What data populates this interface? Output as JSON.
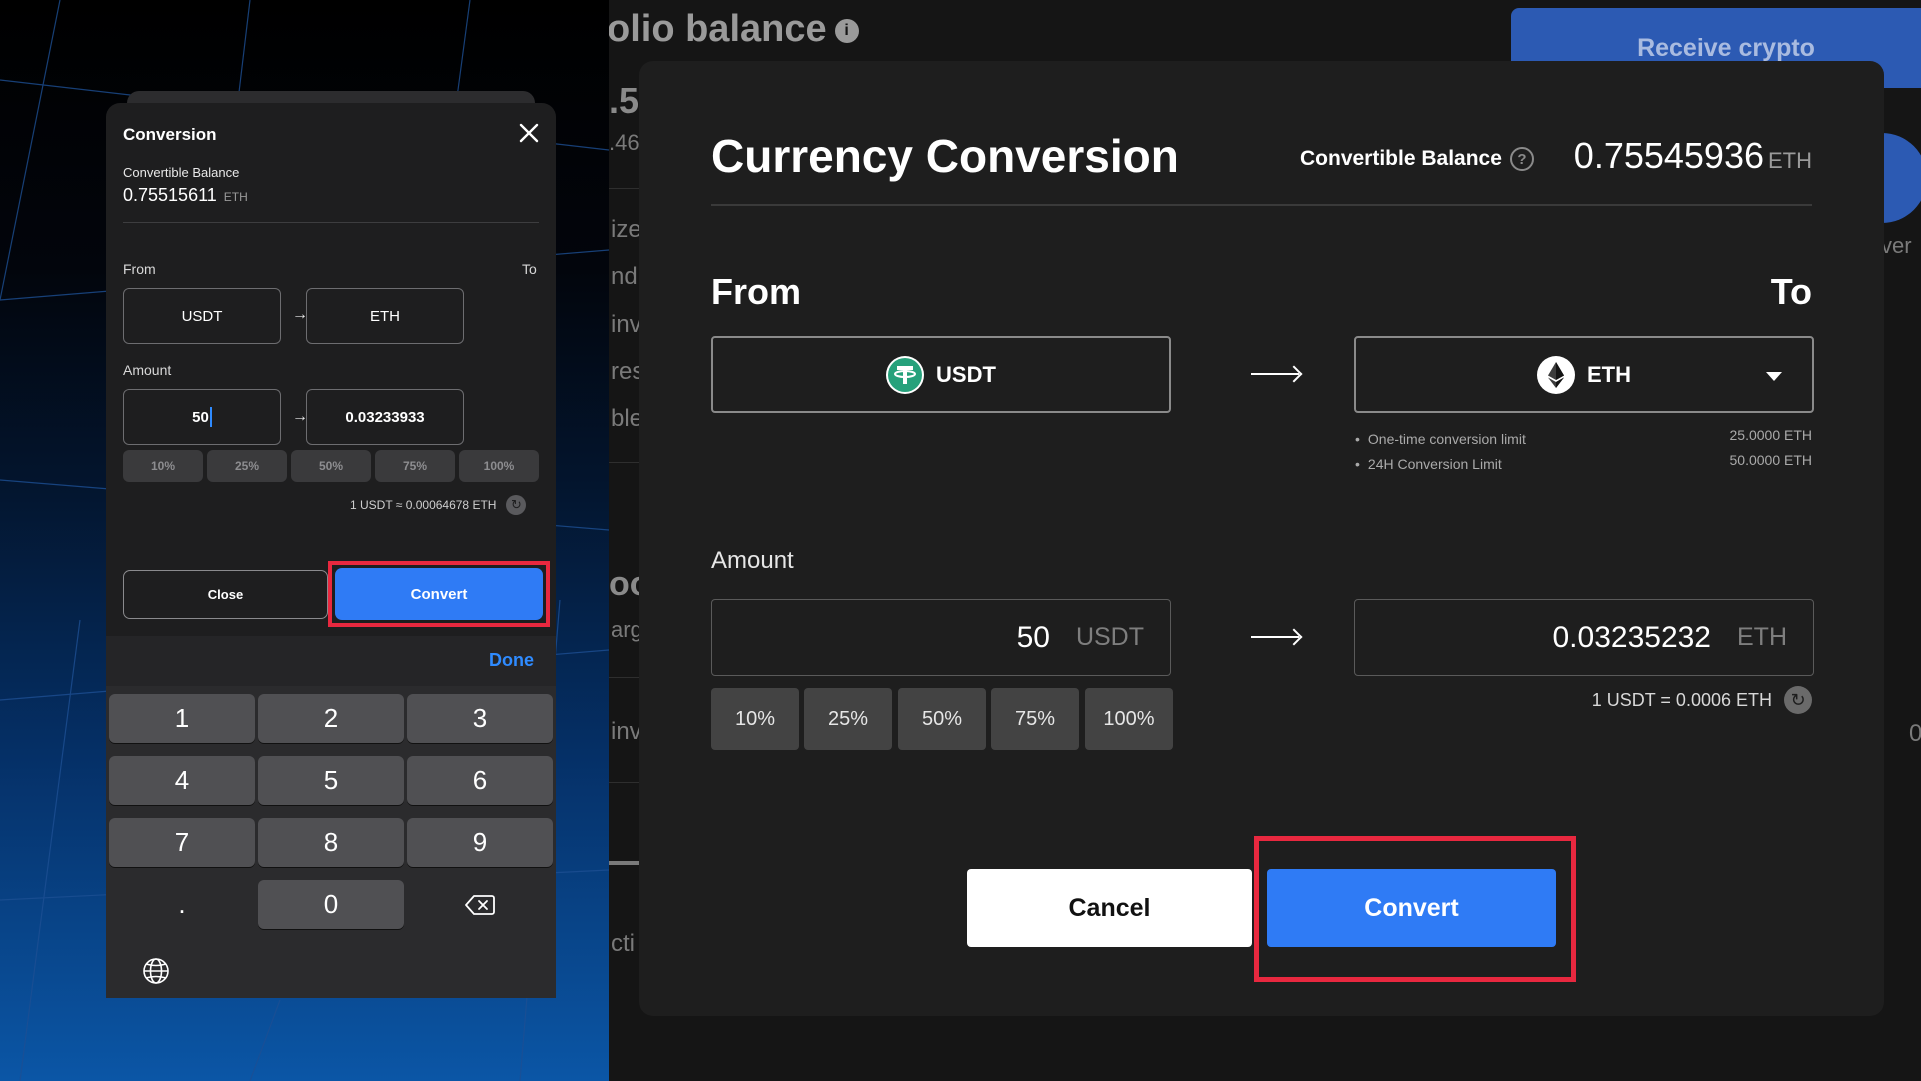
{
  "background": {
    "page_title_fragment": "olio balance",
    "receive_button": "Receive crypto",
    "fragments": [
      ".5",
      ".46",
      "ize",
      "ndi",
      "inv",
      "res",
      "ble",
      "oo",
      "arg",
      "inv",
      "cti",
      "ver",
      "0"
    ]
  },
  "mobile": {
    "title": "Conversion",
    "balance_label": "Convertible Balance",
    "balance_value": "0.75515611",
    "balance_unit": "ETH",
    "from_label": "From",
    "to_label": "To",
    "from_currency": "USDT",
    "to_currency": "ETH",
    "arrow": "→",
    "amount_label": "Amount",
    "amount_value": "50",
    "converted_value": "0.03233933",
    "percent_buttons": [
      "10%",
      "25%",
      "50%",
      "75%",
      "100%"
    ],
    "rate_text": "1 USDT ≈ 0.00064678 ETH",
    "close_label": "Close",
    "convert_label": "Convert"
  },
  "keyboard": {
    "done_label": "Done",
    "keys": [
      "1",
      "2",
      "3",
      "4",
      "5",
      "6",
      "7",
      "8",
      "9",
      ".",
      "0"
    ],
    "backspace_icon": "backspace-icon",
    "globe_icon": "globe-icon"
  },
  "modal": {
    "title": "Currency Conversion",
    "balance_label": "Convertible Balance",
    "balance_value": "0.75545936",
    "balance_unit": "ETH",
    "from_label": "From",
    "to_label": "To",
    "from_currency": "USDT",
    "to_currency": "ETH",
    "limits": [
      {
        "label": "One-time conversion limit",
        "value": "25.0000 ETH"
      },
      {
        "label": "24H Conversion Limit",
        "value": "50.0000 ETH"
      }
    ],
    "amount_label": "Amount",
    "amount_value": "50",
    "amount_unit": "USDT",
    "converted_value": "0.03235232",
    "converted_unit": "ETH",
    "percent_buttons": [
      "10%",
      "25%",
      "50%",
      "75%",
      "100%"
    ],
    "rate_text": "1 USDT = 0.0006 ETH",
    "cancel_label": "Cancel",
    "convert_label": "Convert"
  },
  "colors": {
    "accent_blue": "#2f7bf5",
    "highlight_red": "#e8283f",
    "modal_bg": "#1e1e1e"
  }
}
